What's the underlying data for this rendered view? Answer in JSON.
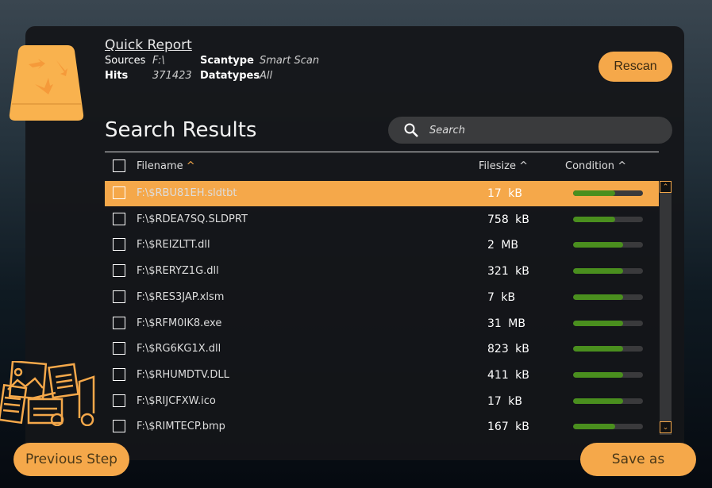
{
  "report": {
    "title": "Quick Report",
    "sources_label": "Sources",
    "sources": "F:\\",
    "hits_label": "Hits",
    "hits": "371423",
    "scantype_label": "Scantype",
    "scantype": "Smart Scan",
    "datatypes_label": "Datatypes",
    "datatypes": "All"
  },
  "rescan": "Rescan",
  "title": "Search Results",
  "search": {
    "placeholder": "Search"
  },
  "columns": {
    "filename": "Filename",
    "filesize": "Filesize",
    "condition": "Condition"
  },
  "accent": "#f5a84a",
  "condition_color": "#4a8f1e",
  "rows": [
    {
      "name": "F:\\$RBU81EH.sldtbt",
      "size": "17 kB",
      "condition": 60,
      "selected": true
    },
    {
      "name": "F:\\$RDEA7SQ.SLDPRT",
      "size": "758 kB",
      "condition": 60
    },
    {
      "name": "F:\\$REIZLTT.dll",
      "size": "2 MB",
      "condition": 72
    },
    {
      "name": "F:\\$RERYZ1G.dll",
      "size": "321 kB",
      "condition": 72
    },
    {
      "name": "F:\\$RES3JAP.xlsm",
      "size": "7 kB",
      "condition": 72
    },
    {
      "name": "F:\\$RFM0IK8.exe",
      "size": "31 MB",
      "condition": 72
    },
    {
      "name": "F:\\$RG6KG1X.dll",
      "size": "823 kB",
      "condition": 72
    },
    {
      "name": "F:\\$RHUMDTV.DLL",
      "size": "411 kB",
      "condition": 72
    },
    {
      "name": "F:\\$RIJCFXW.ico",
      "size": "17 kB",
      "condition": 72
    },
    {
      "name": "F:\\$RIMTECP.bmp",
      "size": "167 kB",
      "condition": 60
    }
  ],
  "prev": "Previous Step",
  "save": "Save as"
}
